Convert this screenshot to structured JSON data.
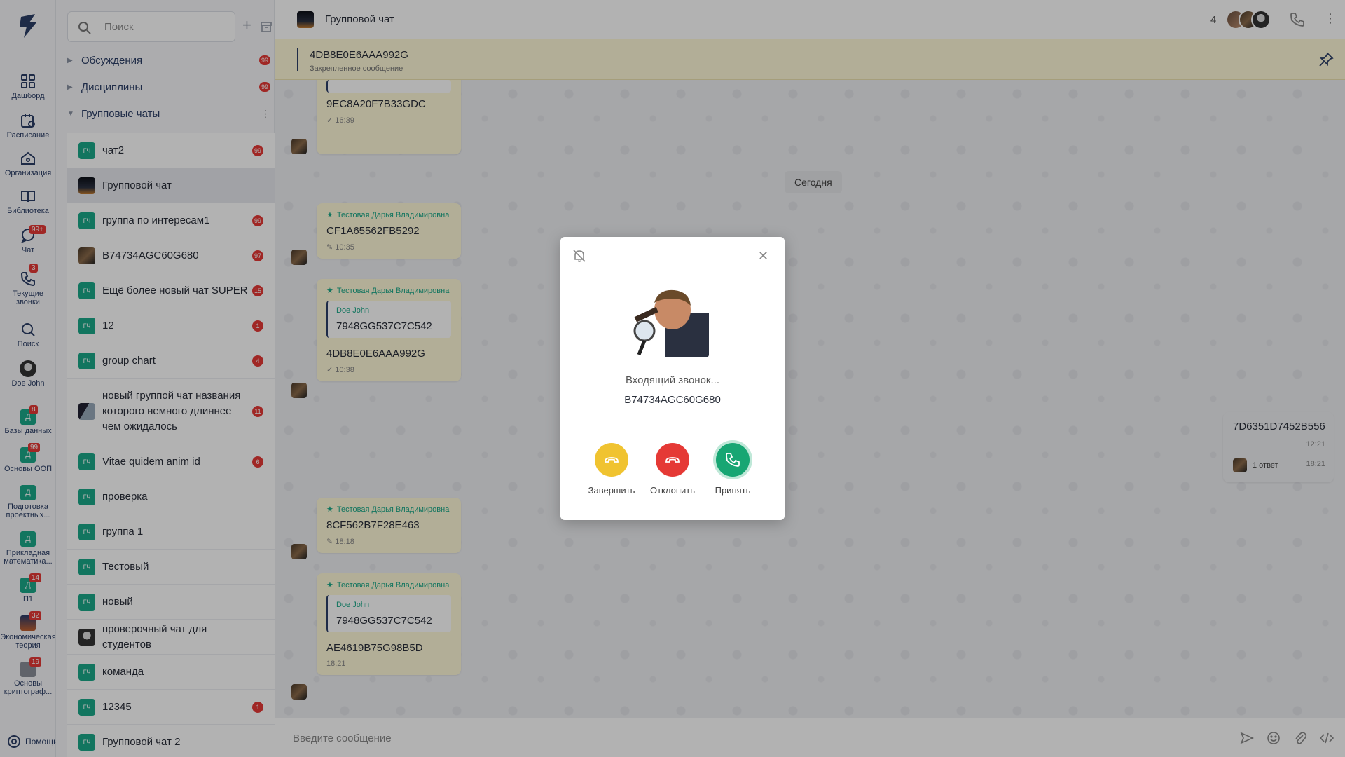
{
  "rail": {
    "items": [
      {
        "label": "Дашборд",
        "icon": "dashboard-icon"
      },
      {
        "label": "Расписание",
        "icon": "schedule-icon"
      },
      {
        "label": "Организация",
        "icon": "organization-icon"
      },
      {
        "label": "Библиотека",
        "icon": "library-icon"
      },
      {
        "label": "Чат",
        "icon": "chat-icon",
        "badge": "99+"
      },
      {
        "label": "Текущие звонки",
        "icon": "phone-icon",
        "badge": "3"
      },
      {
        "label": "Поиск",
        "icon": "search-icon"
      },
      {
        "label": "Doe John",
        "icon": "user-avatar"
      }
    ],
    "databases": [
      {
        "label": "Базы данных",
        "letter": "Д",
        "badge": "8"
      },
      {
        "label": "Основы ООП",
        "letter": "Д",
        "badge": "99"
      },
      {
        "label": "Подготовка проектных...",
        "letter": "Д",
        "badge": ""
      },
      {
        "label": "Прикладная математика...",
        "letter": "Д",
        "badge": ""
      },
      {
        "label": "П1",
        "letter": "Д",
        "badge": "14"
      },
      {
        "label": "Экономическая теория",
        "letter": "",
        "badge": "32"
      },
      {
        "label": "Основы криптограф...",
        "letter": "",
        "badge": "19"
      }
    ],
    "help": "Помощь"
  },
  "sidebar": {
    "search_placeholder": "Поиск",
    "sections": [
      {
        "label": "Обсуждения",
        "badge": "99"
      },
      {
        "label": "Дисциплины",
        "badge": "99"
      },
      {
        "label": "Групповые чаты",
        "badge": ""
      }
    ],
    "chats": [
      {
        "name": "чат2",
        "badge": "99",
        "avatar": "ГЧ"
      },
      {
        "name": "Групповой чат",
        "badge": "",
        "avatar": ""
      },
      {
        "name": "группа по интересам1",
        "badge": "99",
        "avatar": "ГЧ"
      },
      {
        "name": "B74734AGC60G680",
        "badge": "97",
        "avatar": ""
      },
      {
        "name": "Ещё более новый чат SUPER",
        "badge": "15",
        "avatar": "ГЧ"
      },
      {
        "name": "12",
        "badge": "1",
        "avatar": "ГЧ"
      },
      {
        "name": "group chart",
        "badge": "4",
        "avatar": "ГЧ"
      },
      {
        "name": "новый группой чат названия которого немного длиннее чем ожидалось",
        "badge": "11",
        "avatar": ""
      },
      {
        "name": "Vitae quidem anim id",
        "badge": "6",
        "avatar": "ГЧ"
      },
      {
        "name": "проверка",
        "badge": "",
        "avatar": "ГЧ"
      },
      {
        "name": "группа 1",
        "badge": "",
        "avatar": "ГЧ"
      },
      {
        "name": "Тестовый",
        "badge": "",
        "avatar": "ГЧ"
      },
      {
        "name": "новый",
        "badge": "",
        "avatar": "ГЧ"
      },
      {
        "name": "проверочный чат для студентов",
        "badge": "",
        "avatar": ""
      },
      {
        "name": "команда",
        "badge": "",
        "avatar": "ГЧ"
      },
      {
        "name": "12345",
        "badge": "1",
        "avatar": "ГЧ"
      },
      {
        "name": "Групповой чат 2",
        "badge": "",
        "avatar": "ГЧ"
      }
    ]
  },
  "header": {
    "title": "Групповой чат",
    "member_count": "4"
  },
  "pinned": {
    "text": "4DB8E0E6AAA992G",
    "subtitle": "Закрепленное сообщение"
  },
  "messages": {
    "date_chip": "Сегодня",
    "items": [
      {
        "author": "",
        "text": "9EC8A20F7B33GDC",
        "time": "16:39"
      },
      {
        "author": "Тестовая Дарья Владимировна",
        "text": "CF1A65562FB5292",
        "time": "10:35"
      },
      {
        "author": "Тестовая Дарья Владимировна",
        "quote_author": "Doe John",
        "quote_text": "7948GG537C7C542",
        "text": "4DB8E0E6AAA992G",
        "time": "10:38"
      },
      {
        "author": "Тестовая Дарья Владимировна",
        "text": "8CF562B7F28E463",
        "time": "18:18"
      },
      {
        "author": "Тестовая Дарья Владимировна",
        "quote_author": "Doe John",
        "quote_text": "7948GG537C7C542",
        "text": "AE4619B75G98B5D",
        "time": "18:21"
      }
    ],
    "own": {
      "text": "7D6351D7452B556",
      "time": "12:21",
      "replies": "1 ответ",
      "reply_time": "18:21"
    }
  },
  "composer": {
    "placeholder": "Введите сообщение"
  },
  "call_dialog": {
    "status": "Входящий звонок...",
    "caller": "B74734AGC60G680",
    "buttons": {
      "end": "Завершить",
      "decline": "Отклонить",
      "accept": "Принять"
    },
    "colors": {
      "end": "#f0c330",
      "decline": "#e53935",
      "accept": "#17a673"
    }
  }
}
